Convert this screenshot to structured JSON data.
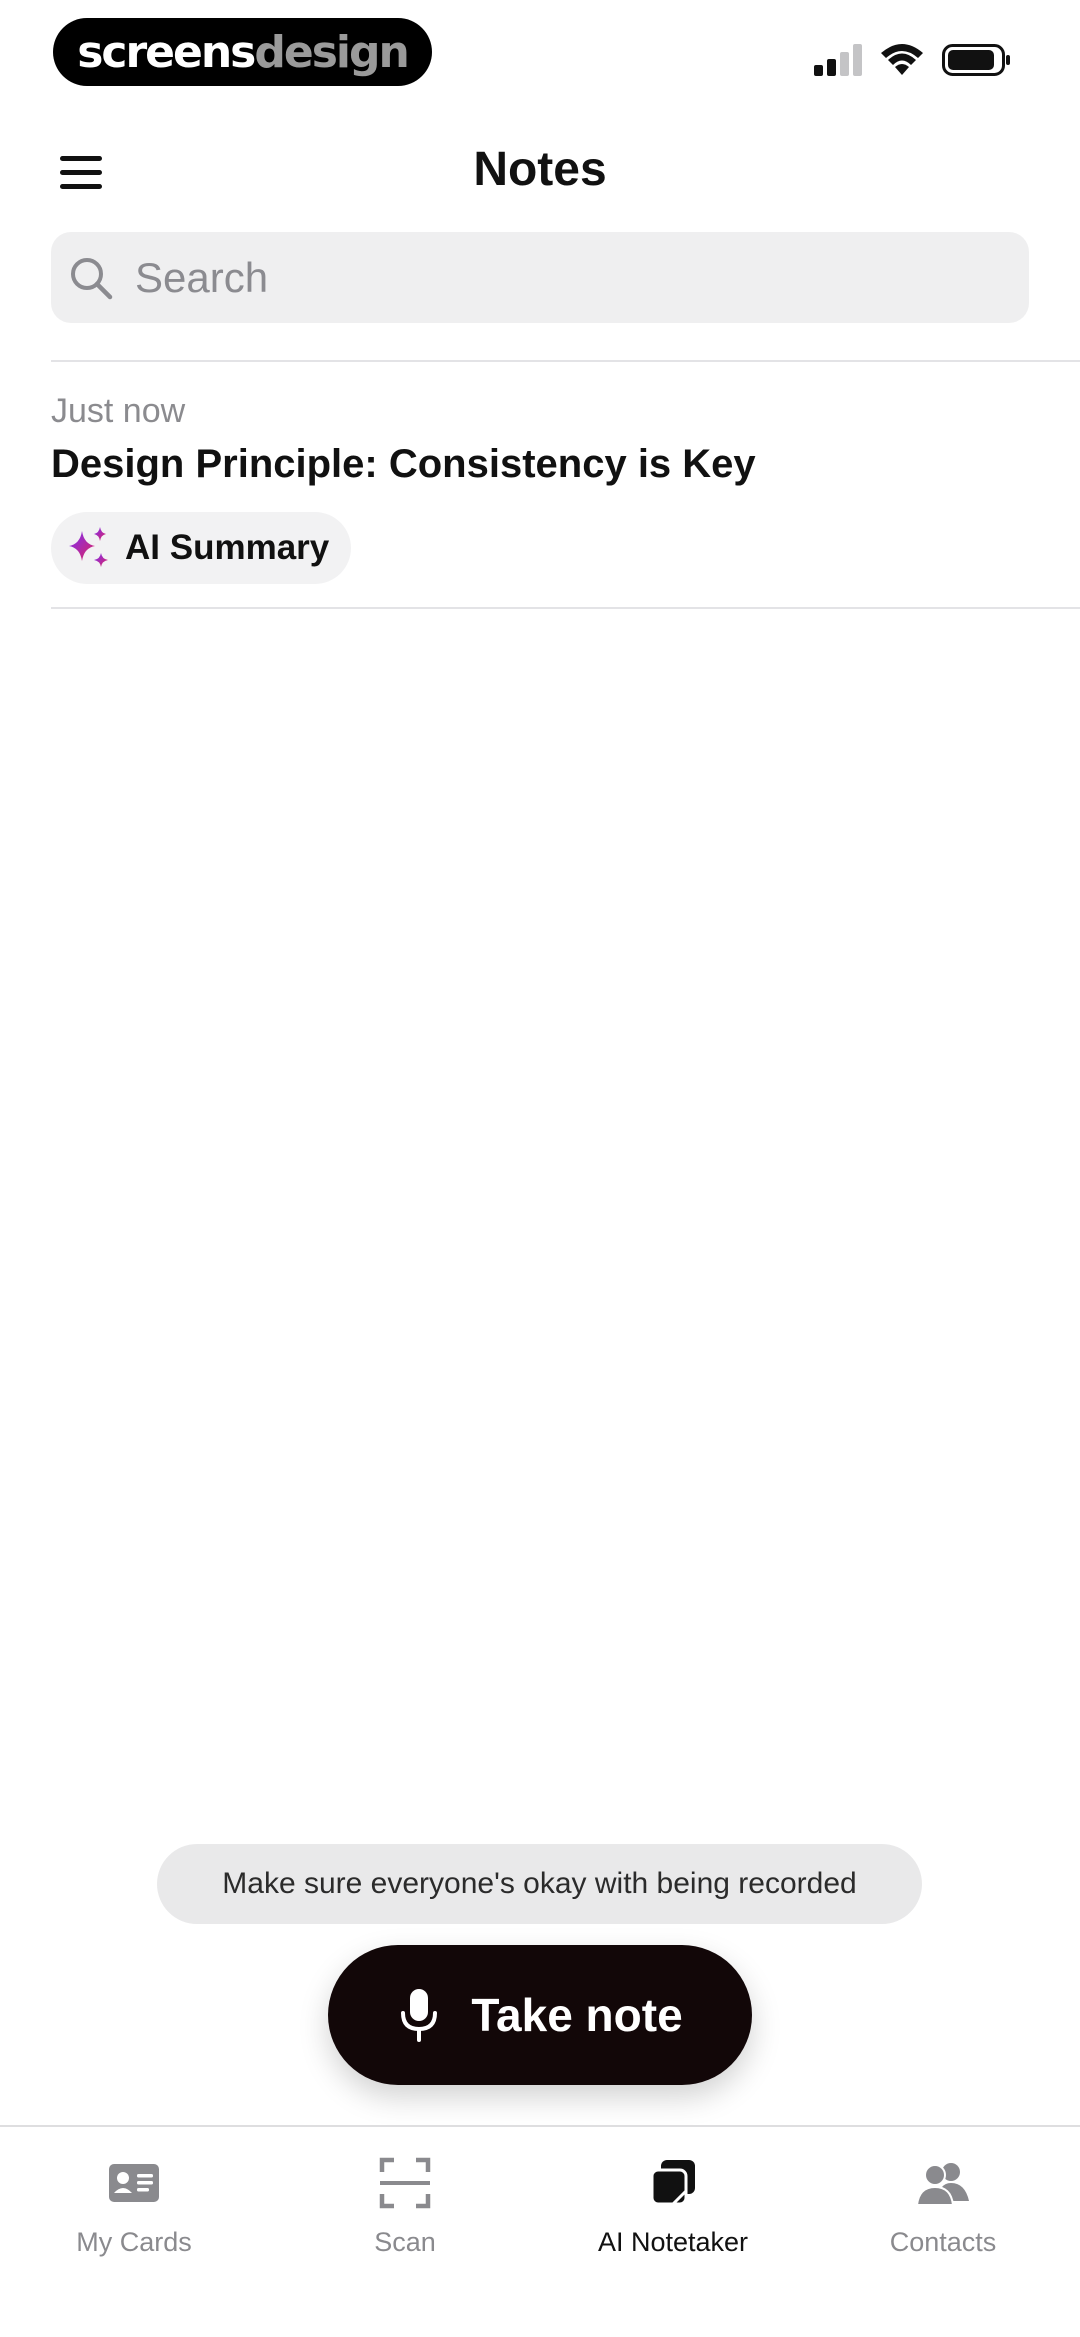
{
  "status_bar": {
    "brand_primary": "screens",
    "brand_secondary": "design",
    "icons": [
      "cellular-signal-icon",
      "wifi-icon",
      "battery-icon"
    ]
  },
  "header": {
    "title": "Notes",
    "menu_icon": "hamburger-menu-icon"
  },
  "search": {
    "placeholder": "Search",
    "value": "",
    "icon": "search-icon"
  },
  "notes": [
    {
      "time": "Just now",
      "title": "Design Principle: Consistency is Key",
      "chip_label": "AI Summary",
      "chip_icon": "sparkle-icon"
    }
  ],
  "toast": {
    "text": "Make sure everyone's okay with being recorded"
  },
  "primary_action": {
    "label": "Take note",
    "icon": "microphone-icon"
  },
  "tab_bar": {
    "active": "AI Notetaker",
    "items": [
      {
        "label": "My Cards",
        "icon": "id-card-icon"
      },
      {
        "label": "Scan",
        "icon": "scan-frame-icon"
      },
      {
        "label": "AI Notetaker",
        "icon": "notes-stack-icon"
      },
      {
        "label": "Contacts",
        "icon": "people-icon"
      }
    ]
  },
  "colors": {
    "background": "#ffffff",
    "primary_button": "#120708",
    "search_fill": "#efeff0",
    "muted_text": "#8b8b8f",
    "sparkle_gradient": [
      "#7b2ff7",
      "#e0245e"
    ]
  }
}
